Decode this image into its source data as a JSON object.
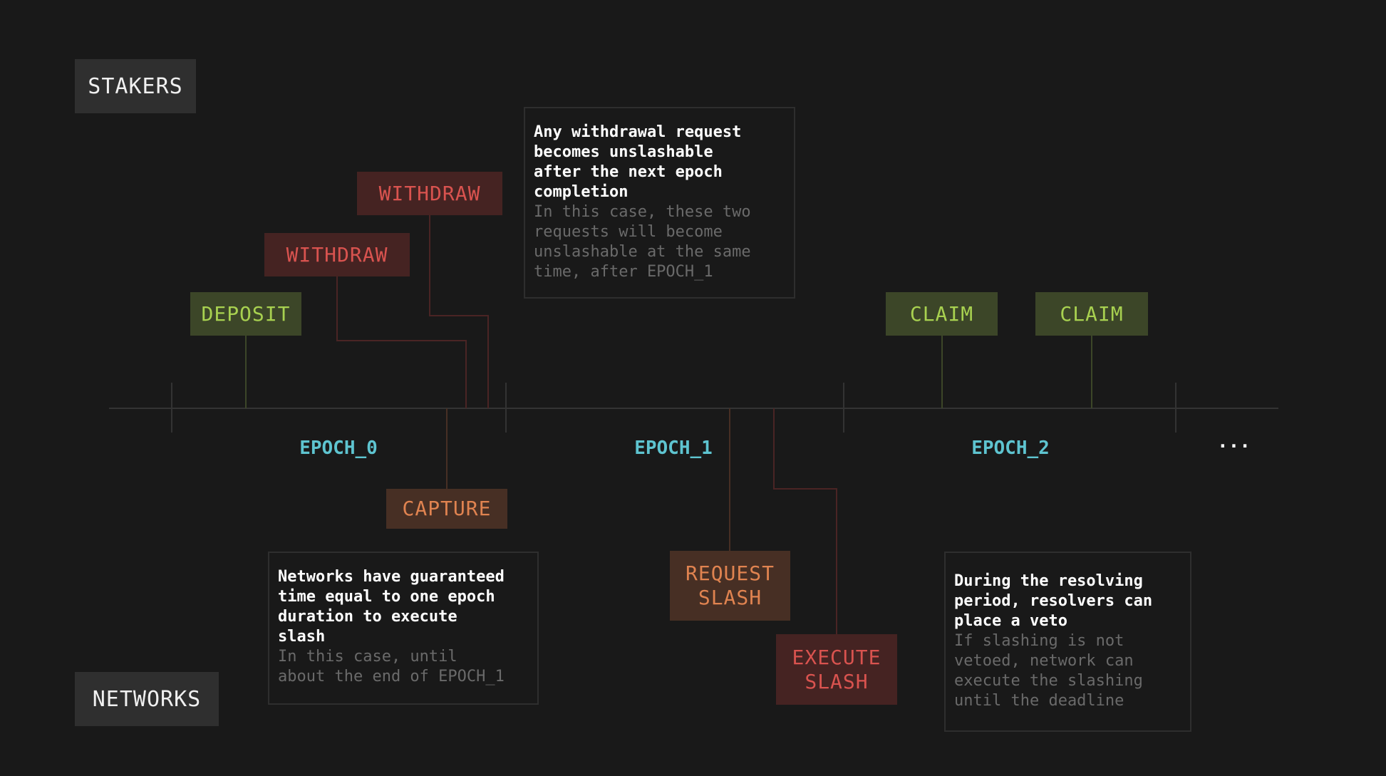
{
  "roles": {
    "stakers": "STAKERS",
    "networks": "NETWORKS"
  },
  "epochs": [
    "EPOCH_0",
    "EPOCH_1",
    "EPOCH_2"
  ],
  "ellipsis": "...",
  "staker_events": {
    "deposit": "DEPOSIT",
    "withdraw_1": "WITHDRAW",
    "withdraw_2": "WITHDRAW",
    "claim_1": "CLAIM",
    "claim_2": "CLAIM"
  },
  "network_events": {
    "capture": "CAPTURE",
    "request_slash": "REQUEST\nSLASH",
    "execute_slash": "EXECUTE\nSLASH"
  },
  "notes": {
    "withdrawal": {
      "headline": "Any withdrawal request\nbecomes unslashable\nafter the next epoch\ncompletion",
      "detail": "In this case, these two\nrequests will become\nunslashable at the same\ntime, after EPOCH_1"
    },
    "guarantee": {
      "headline": "Networks have guaranteed\ntime equal to one epoch\nduration to execute\nslash",
      "detail": "In this case, until\nabout the end of EPOCH_1"
    },
    "veto": {
      "headline": "During the resolving\nperiod, resolvers can\nplace a veto",
      "detail": "If slashing is not\nvetoed, network can\nexecute the slashing\nuntil the deadline"
    },
    "colors": {
      "timeline": "#333333",
      "green": "#a8d150",
      "red": "#d9534f",
      "orange": "#e08350",
      "epoch": "#5ec4d0"
    }
  }
}
